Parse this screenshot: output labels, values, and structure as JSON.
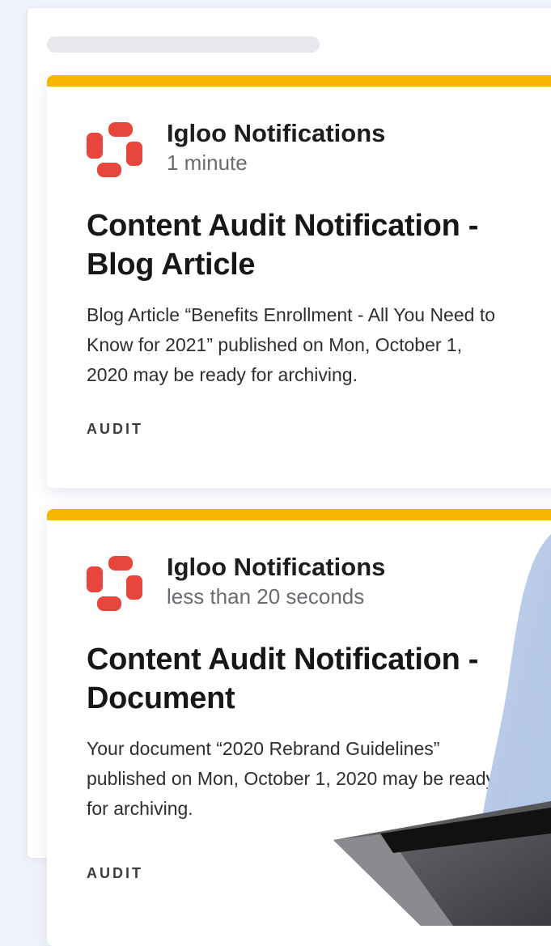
{
  "notifications": [
    {
      "sender": "Igloo Notifications",
      "time": "1 minute",
      "title": "Content Audit Notification - Blog Article",
      "body": "Blog Article “Benefits Enrollment - All You Need to Know for 2021” published on Mon, October 1, 2020 may be ready for archiving.",
      "tag": "AUDIT"
    },
    {
      "sender": "Igloo Notifications",
      "time": "less than 20 seconds",
      "title": "Content Audit Notification - Document",
      "body": "Your document “2020 Rebrand Guidelines” published on Mon, October 1, 2020 may be ready for archiving.",
      "tag": "AUDIT"
    }
  ],
  "colors": {
    "accent": "#f5b700",
    "logo": "#e8453c",
    "page_background": "#f1f3fa"
  },
  "icons": {
    "logo": "igloo-logo-icon"
  }
}
